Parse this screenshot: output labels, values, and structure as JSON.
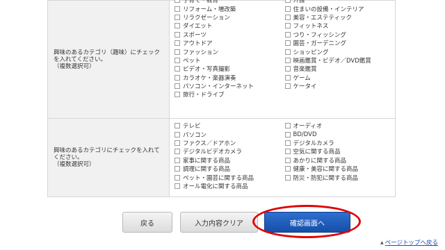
{
  "interests": {
    "label": "興味のあるカテゴリ（趣味）にチェックを入れてください。\n（複数選択可）",
    "left_column": [
      "子育て・教育",
      "リフォーム・増改築",
      "リラクゼーション",
      "ダイエット",
      "スポーツ",
      "アウトドア",
      "ファッション",
      "ペット",
      "ビデオ・写真撮影",
      "カラオケ・楽器演奏",
      "パソコン・インターネット",
      "旅行・ドライブ"
    ],
    "right_column": [
      "介護",
      "住まいの設備・インテリア",
      "美容・エステティック",
      "フィットネス",
      "つり・フィッシング",
      "園芸・ガーデニング",
      "ショッピング",
      "映画鑑賞・ビデオ／DVD鑑賞",
      "音楽鑑賞",
      "ゲーム",
      "ケータイ"
    ]
  },
  "electronics": {
    "label": "興味のあるカテゴリにチェックを入れてください。\n（複数選択可）",
    "left_column": [
      "テレビ",
      "パソコン",
      "ファクス／ドアホン",
      "デジタルビデオカメラ",
      "家事に関する商品",
      "調理に関する商品",
      "ペット・園芸に関する商品",
      "オール電化に関する商品"
    ],
    "right_column": [
      "オーディオ",
      "BD/DVD",
      "デジタルカメラ",
      "空気に関する商品",
      "あかりに関する商品",
      "健康・美容に関する商品",
      "防災・防犯に関する商品"
    ]
  },
  "buttons": {
    "back": "戻る",
    "clear": "入力内容クリア",
    "confirm": "確認画面へ"
  },
  "footer": {
    "page_top": "ページトップへ戻る"
  },
  "colors": {
    "confirm_button": "#1a5bbf",
    "highlight": "#e00000",
    "header_cell": "#f1f1f1",
    "link": "#1a4fb0"
  }
}
